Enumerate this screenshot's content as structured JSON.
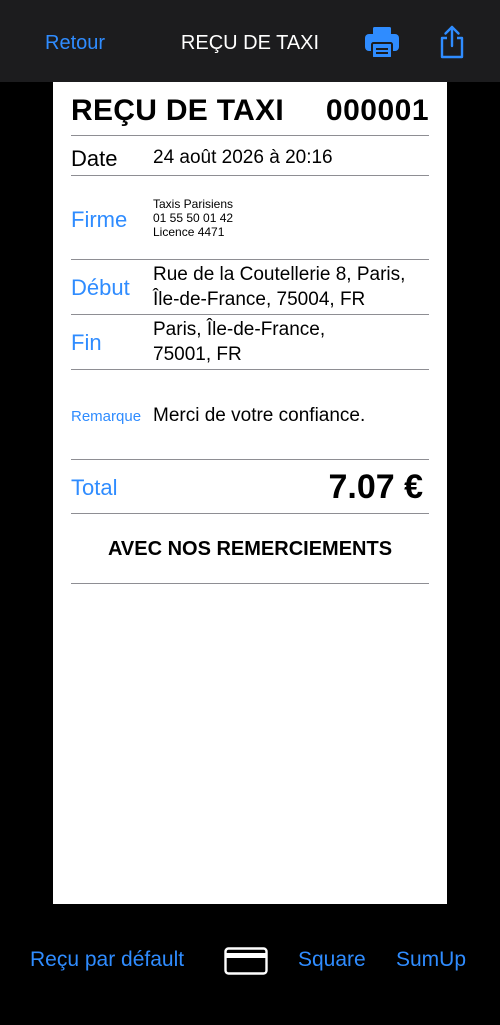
{
  "nav": {
    "back_label": "Retour",
    "title": "REÇU DE TAXI",
    "print_icon": "printer-icon",
    "share_icon": "share-icon"
  },
  "receipt": {
    "title": "REÇU DE TAXI",
    "number": "000001",
    "date_label": "Date",
    "date_value": "24 août 2026 à 20:16",
    "company_label": "Firme",
    "company_lines": [
      "Taxis Parisiens",
      "01 55 50 01 42",
      "Licence 4471"
    ],
    "start_label": "Début",
    "start_lines": [
      "Rue de la Coutellerie 8, Paris,",
      "Île-de-France, 75004, FR"
    ],
    "end_label": "Fin",
    "end_lines": [
      "Paris, Île-de-France,",
      "75001, FR"
    ],
    "remark_label": "Remarque",
    "remark_value": "Merci de votre confiance.",
    "total_label": "Total",
    "total_value": "7.07 €",
    "thanks": "AVEC NOS REMERCIEMENTS"
  },
  "toolbar": {
    "default_receipt": "Reçu par défault",
    "card_icon": "credit-card-icon",
    "square": "Square",
    "sumup": "SumUp"
  },
  "colors": {
    "accent": "#2f8cff",
    "navbar_bg": "#1c1c1e",
    "paper_bg": "#ffffff",
    "background": "#000000"
  }
}
